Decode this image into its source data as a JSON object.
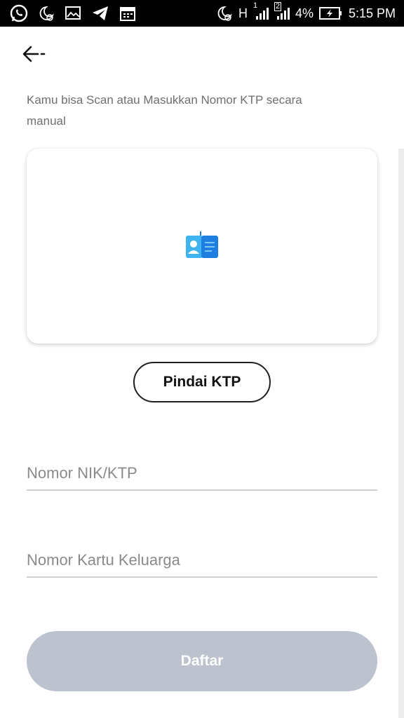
{
  "status_bar": {
    "battery": "4%",
    "time": "5:15 PM",
    "network_h": "H",
    "sim1": "1",
    "sim2": "2",
    "left_icons": [
      "whatsapp-icon",
      "moon-alarm-icon",
      "gallery-icon",
      "telegram-icon",
      "calendar-icon"
    ],
    "right_icons": [
      "moon-alarm-icon",
      "network-h-icon",
      "signal-icon",
      "signal-icon",
      "battery-charging-icon"
    ]
  },
  "header": {
    "back_icon": "back-arrow-icon"
  },
  "instruction": {
    "text": "Kamu bisa Scan atau Masukkan Nomor KTP secara manual"
  },
  "scan_card": {
    "icon": "id-card-icon",
    "colors": {
      "light": "#3fb4f0",
      "dark": "#1e7fe0"
    }
  },
  "scan_button": {
    "label": "Pindai KTP"
  },
  "form": {
    "nik_placeholder": "Nomor NIK/KTP",
    "kk_placeholder": "Nomor Kartu Keluarga"
  },
  "submit_button": {
    "label": "Daftar",
    "color": "#bcc3cf"
  }
}
